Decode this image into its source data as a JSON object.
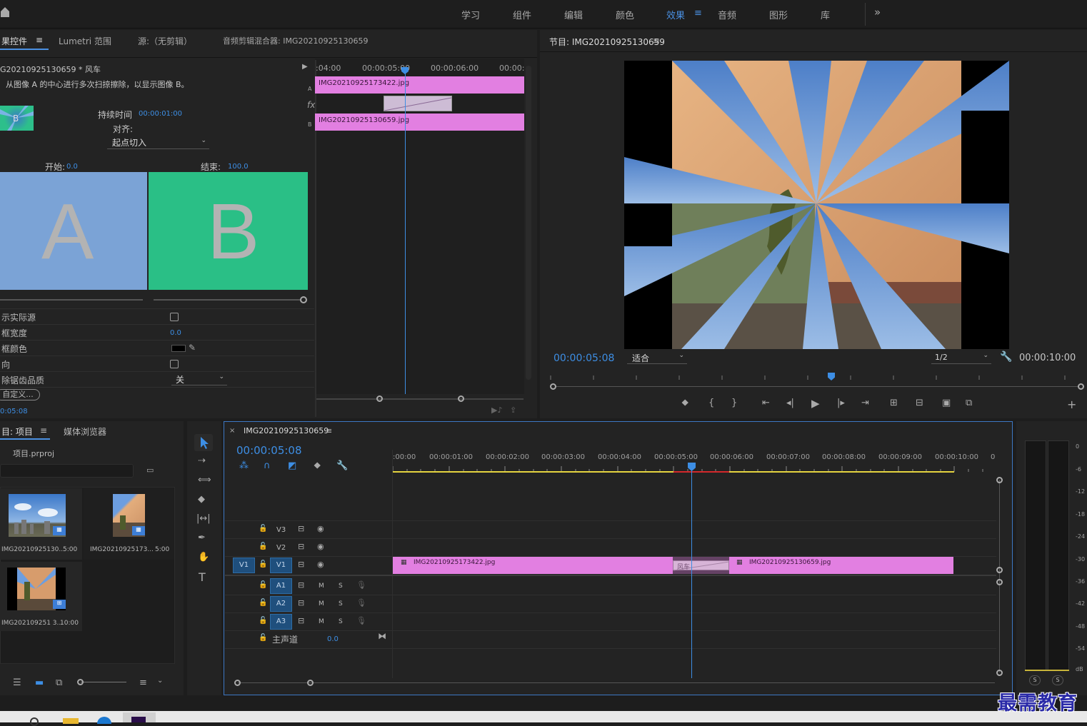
{
  "workspaces": [
    "学习",
    "组件",
    "编辑",
    "颜色",
    "效果",
    "音频",
    "图形",
    "库"
  ],
  "workspace_active": "效果",
  "top_left_panel": {
    "tabs": [
      "果控件",
      "Lumetri 范围",
      "源:（无剪辑）",
      "音频剪辑混合器: IMG20210925130659"
    ],
    "clip_name": "G20210925130659 * 风车",
    "description": "从图像 A 的中心进行多次扫掠擦除，以显示图像 B。",
    "duration_label": "持续时间",
    "duration_value": "00:00:01:00",
    "align_label": "对齐:",
    "align_value": "起点切入",
    "start_label": "开始:",
    "start_value": "0.0",
    "end_label": "结束:",
    "end_value": "100.0",
    "thumb_a": "A",
    "thumb_b": "B",
    "props": [
      {
        "label": "示实际源",
        "type": "checkbox",
        "value": ""
      },
      {
        "label": "框宽度",
        "type": "number",
        "value": "0.0"
      },
      {
        "label": "框颜色",
        "type": "color",
        "value": ""
      },
      {
        "label": "向",
        "type": "checkbox",
        "value": ""
      },
      {
        "label": "除锯齿品质",
        "type": "select",
        "value": "关"
      }
    ],
    "custom_button": "自定义...",
    "time_readout": "0:05:08",
    "mini_timeline": {
      "ticks": [
        ":04:00",
        "00:00:05:00",
        "00:00:06:00",
        "00:00:"
      ],
      "track_a_label": "A",
      "track_b_label": "B",
      "clip_a": "IMG20210925173422.jpg",
      "clip_b": "IMG20210925130659.jpg",
      "fx": "fx"
    }
  },
  "program_monitor": {
    "title": "节目: IMG20210925130659",
    "timecode": "00:00:05:08",
    "fit": "适合",
    "resolution": "1/2",
    "duration": "00:00:10:00"
  },
  "project_panel": {
    "tabs": [
      "目: 项目",
      "媒体浏览器"
    ],
    "project_file": "项目.prproj",
    "items": [
      {
        "name": "IMG20210925130...",
        "duration": "5:00"
      },
      {
        "name": "IMG20210925173...",
        "duration": "5:00"
      },
      {
        "name": "IMG202109251 3...",
        "duration": "10:00"
      }
    ]
  },
  "sequence": {
    "tab": "IMG20210925130659",
    "timecode": "00:00:05:08",
    "ruler": [
      ":00:00",
      "00:00:01:00",
      "00:00:02:00",
      "00:00:03:00",
      "00:00:04:00",
      "00:00:05:00",
      "00:00:06:00",
      "00:00:07:00",
      "00:00:08:00",
      "00:00:09:00",
      "00:00:10:00",
      "0"
    ],
    "video_tracks": [
      "V3",
      "V2",
      "V1"
    ],
    "audio_tracks": [
      "A1",
      "A2",
      "A3"
    ],
    "source_patch": "V1",
    "master_label": "主声道",
    "master_value": "0.0",
    "clip1": "IMG20210925173422.jpg",
    "transition": "风车",
    "clip2": "IMG20210925130659.jpg",
    "mute": "M",
    "solo": "S"
  },
  "audio_meter": {
    "scale": [
      "0",
      "-6",
      "-12",
      "-18",
      "-24",
      "-30",
      "-36",
      "-42",
      "-48",
      "-54",
      "dB"
    ],
    "solo_buttons": [
      "S",
      "S"
    ]
  },
  "watermark": "最需教育"
}
